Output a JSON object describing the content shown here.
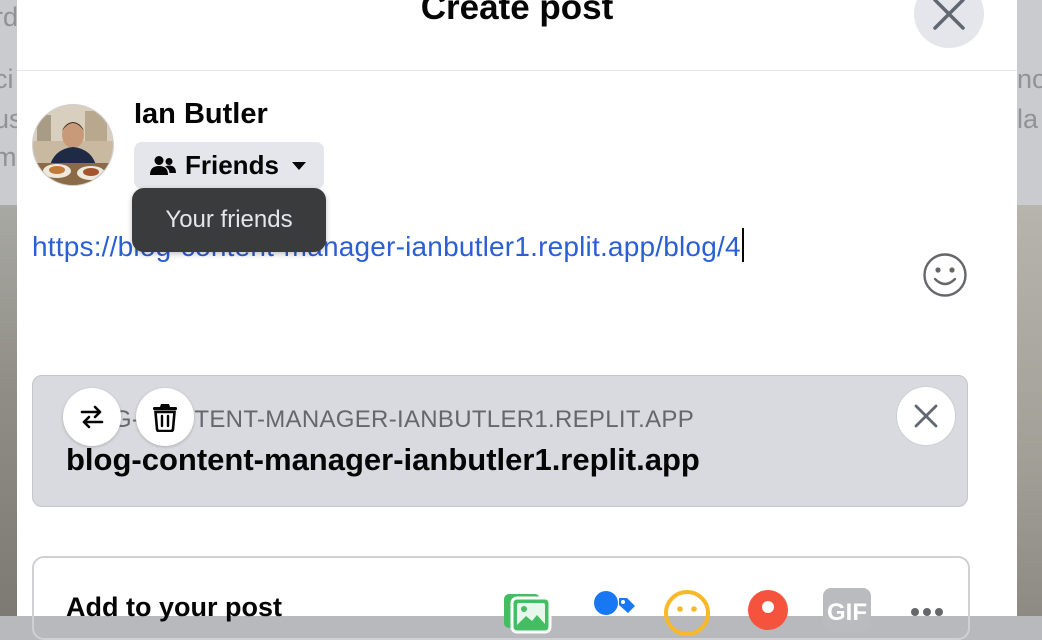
{
  "modal": {
    "title": "Create post"
  },
  "user": {
    "name": "Ian Butler",
    "audience": "Friends",
    "audience_tooltip": "Your friends"
  },
  "post": {
    "text": "https://blog-content-manager-ianbutler1.replit.app/blog/4"
  },
  "link_preview": {
    "domain": "BLOG-CONTENT-MANAGER-IANBUTLER1.REPLIT.APP",
    "title": "blog-content-manager-ianbutler1.replit.app"
  },
  "add_to_post": {
    "label": "Add to your post",
    "tools": [
      "photo-video-icon",
      "tag-people-icon",
      "feeling-icon",
      "check-in-icon",
      "gif-icon",
      "more-icon"
    ],
    "gif_label": "GIF"
  },
  "background": {
    "left_fragments": [
      "rd",
      "ci",
      "us",
      "m"
    ],
    "right_fragments": [
      "no",
      "la"
    ]
  },
  "colors": {
    "link_blue": "#2b5fd6",
    "tooltip_bg": "#3a3b3c",
    "photo_green": "#45bd62",
    "tag_blue": "#1877f2",
    "feeling_yellow": "#f7b928",
    "checkin_red": "#f5533d"
  }
}
